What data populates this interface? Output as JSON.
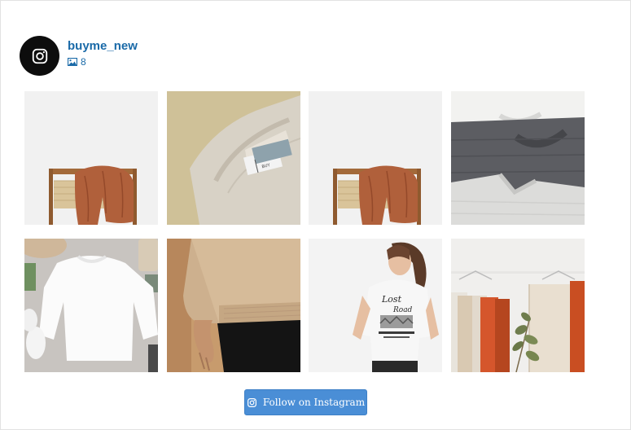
{
  "profile": {
    "username": "buyme_new",
    "post_count": "8",
    "avatar_icon": "instagram-icon",
    "username_color": "#1a6aa8"
  },
  "posts": [
    {
      "subject": "rust knit sweater on wooden chair"
    },
    {
      "subject": "beige sweater with price tag"
    },
    {
      "subject": "rust knit sweater on wooden chair"
    },
    {
      "subject": "stacked grey knit sweaters"
    },
    {
      "subject": "white sweatshirt flat lay"
    },
    {
      "subject": "woman in beige sweater"
    },
    {
      "subject": "woman in graphic t-shirt"
    },
    {
      "subject": "clothing rack with garments"
    }
  ],
  "follow_button": {
    "label": "Follow on Instagram",
    "icon": "instagram-icon",
    "color": "#4a8ed6"
  }
}
